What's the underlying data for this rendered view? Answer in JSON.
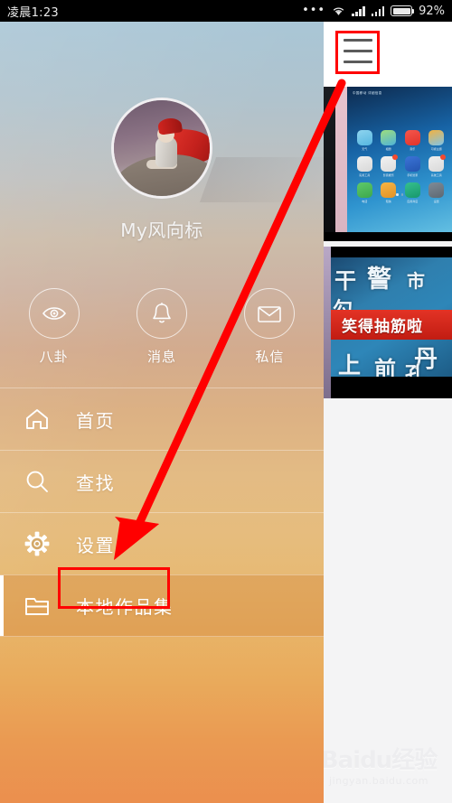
{
  "status_bar": {
    "time": "凌晨1:23",
    "dots_icon": "more-dots-icon",
    "wifi_icon": "wifi-icon",
    "signal1_icon": "signal-bars-icon",
    "signal2_icon": "signal-bars-icon",
    "battery_icon": "battery-icon",
    "battery_percent": "92%"
  },
  "drawer": {
    "profile": {
      "avatar_name": "user-avatar",
      "username": "My风向标"
    },
    "actions": [
      {
        "label": "八卦",
        "icon": "eye-icon"
      },
      {
        "label": "消息",
        "icon": "bell-icon"
      },
      {
        "label": "私信",
        "icon": "envelope-icon"
      }
    ],
    "menu": [
      {
        "label": "首页",
        "icon": "home-icon",
        "active": false
      },
      {
        "label": "查找",
        "icon": "search-icon",
        "active": false
      },
      {
        "label": "设置",
        "icon": "gear-icon",
        "active": false
      },
      {
        "label": "本地作品集",
        "icon": "folder-icon",
        "active": true
      }
    ]
  },
  "content_panel": {
    "hamburger_icon": "hamburger-menu-icon",
    "thumbnails": [
      {
        "name": "phone-home-screen-photo"
      },
      {
        "name": "video-thumbnail-funny"
      }
    ],
    "phone_photo": {
      "status_text": "中国移动 详细信息",
      "apps_row1": [
        {
          "label": "天气",
          "color1": "#8fd4ef",
          "color2": "#55b6e0",
          "badge": false
        },
        {
          "label": "相册",
          "color1": "#9ede7d",
          "color2": "#4fb3d8",
          "badge": false
        },
        {
          "label": "音乐",
          "color1": "#f5564c",
          "color2": "#e0332a",
          "badge": false
        },
        {
          "label": "可视主题",
          "color1": "#f3b23f",
          "color2": "#7fc4e8",
          "badge": false
        }
      ],
      "apps_row2": [
        {
          "label": "实用工具",
          "color1": "#f0f0f0",
          "color2": "#d8d8d8",
          "badge": false
        },
        {
          "label": "影音娱乐",
          "color1": "#f2f2f2",
          "color2": "#dcdcdc",
          "badge": true
        },
        {
          "label": "手机管家",
          "color1": "#3b74d6",
          "color2": "#2455b0",
          "badge": false
        },
        {
          "label": "系统工具",
          "color1": "#efefef",
          "color2": "#d9d9d9",
          "badge": true
        }
      ],
      "apps_row3": [
        {
          "label": "电话",
          "color1": "#5fc96a",
          "color2": "#3da84c",
          "badge": false
        },
        {
          "label": "短信",
          "color1": "#f6b545",
          "color2": "#e09226",
          "badge": false
        },
        {
          "label": "应用商店",
          "color1": "#36c08e",
          "color2": "#17976c",
          "badge": false
        },
        {
          "label": "设置",
          "color1": "#7f8b97",
          "color2": "#5d6872",
          "badge": false
        }
      ]
    },
    "video_photo": {
      "banner_text": "笑得抽筋啦",
      "bg_chars": [
        "干",
        "警",
        "市",
        "勾",
        "丹",
        "前",
        "孔",
        "上"
      ]
    }
  },
  "annotations": {
    "hamburger_box": "red-highlight-box",
    "local-works_box": "red-highlight-box",
    "arrow": "red-arrow-pointing-to-local-works"
  },
  "watermark": {
    "main": "Baidu经验",
    "sub": "jingyan.baidu.com"
  },
  "colors": {
    "annotation_red": "#ff0000",
    "drawer_top": "#a9c6d6",
    "drawer_bottom": "#eb8f4e",
    "panel_bg": "#f4f4f5"
  }
}
